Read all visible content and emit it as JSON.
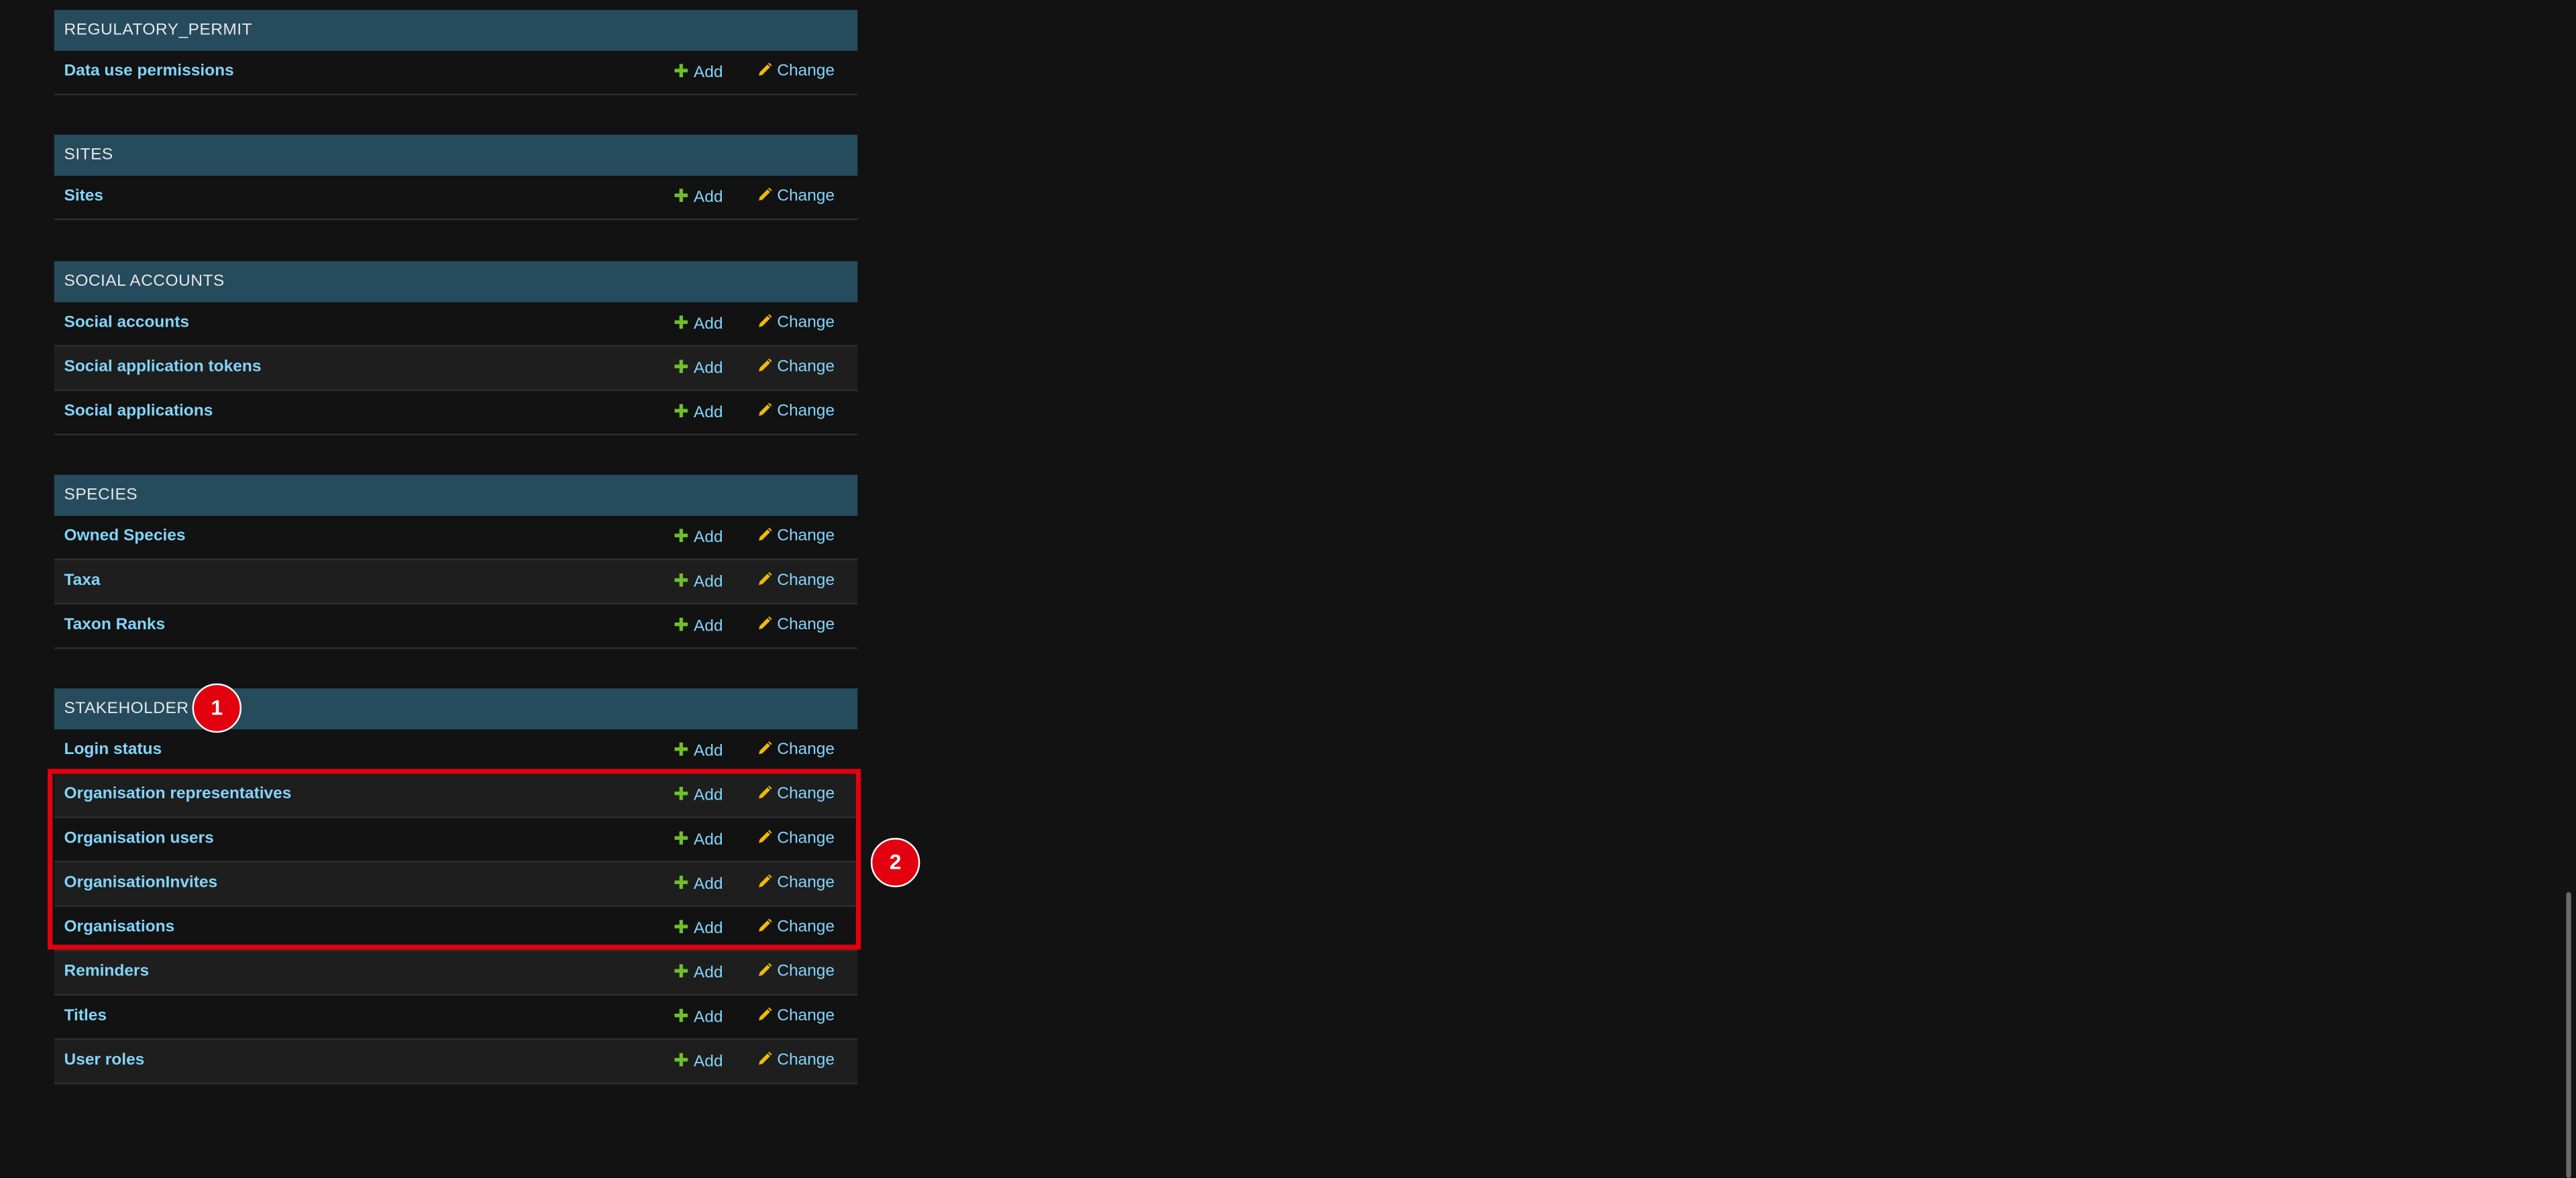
{
  "labels": {
    "add": "Add",
    "change": "Change"
  },
  "modules": [
    {
      "caption": "REGULATORY_PERMIT",
      "rows": [
        "Data use permissions"
      ]
    },
    {
      "caption": "SITES",
      "rows": [
        "Sites"
      ]
    },
    {
      "caption": "SOCIAL ACCOUNTS",
      "rows": [
        "Social accounts",
        "Social application tokens",
        "Social applications"
      ]
    },
    {
      "caption": "SPECIES",
      "rows": [
        "Owned Species",
        "Taxa",
        "Taxon Ranks"
      ]
    },
    {
      "caption": "STAKEHOLDER",
      "rows": [
        "Login status",
        "Organisation representatives",
        "Organisation users",
        "OrganisationInvites",
        "Organisations",
        "Reminders",
        "Titles",
        "User roles"
      ]
    }
  ],
  "annotations": {
    "marker_1": "1",
    "marker_2": "2"
  },
  "colors": {
    "background": "#121212",
    "caption_bg": "#264b5d",
    "link": "#81d4fa",
    "add_icon": "#70bf2b",
    "change_icon": "#efb80b",
    "annotation": "#e3000f"
  }
}
